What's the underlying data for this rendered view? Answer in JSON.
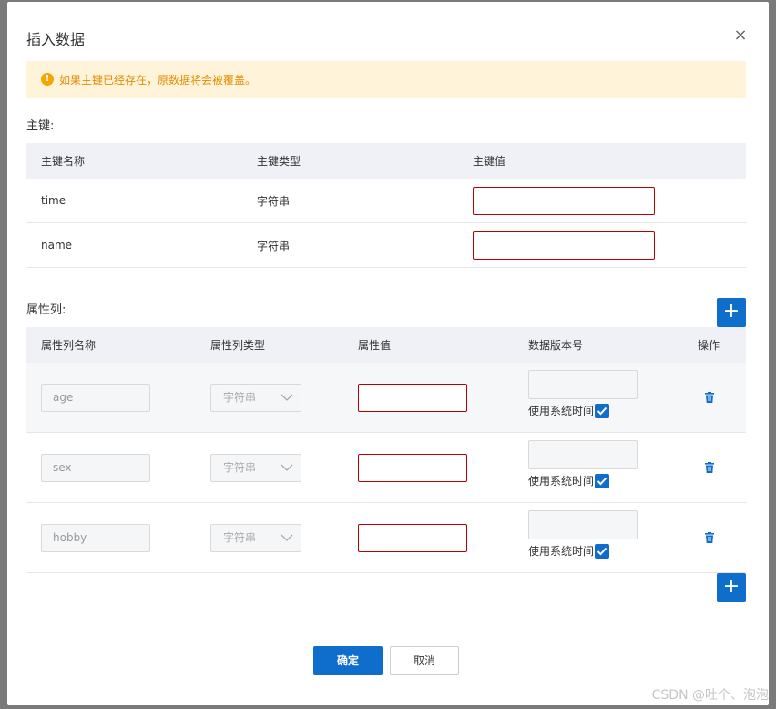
{
  "dialog": {
    "title": "插入数据",
    "close_icon": "×"
  },
  "alert": {
    "icon": "!",
    "text": "如果主键已经存在，原数据将会被覆盖。"
  },
  "primary_keys": {
    "section_label": "主键:",
    "headers": [
      "主键名称",
      "主键类型",
      "主键值"
    ],
    "rows": [
      {
        "name": "time",
        "type": "字符串",
        "value": ""
      },
      {
        "name": "name",
        "type": "字符串",
        "value": ""
      }
    ]
  },
  "attributes": {
    "section_label": "属性列:",
    "headers": [
      "属性列名称",
      "属性列类型",
      "属性值",
      "数据版本号",
      "操作"
    ],
    "rows": [
      {
        "name": "age",
        "type": "字符串",
        "value": "",
        "version": "",
        "use_system_time": "使用系统时间",
        "checked": true
      },
      {
        "name": "sex",
        "type": "字符串",
        "value": "",
        "version": "",
        "use_system_time": "使用系统时间",
        "checked": true
      },
      {
        "name": "hobby",
        "type": "字符串",
        "value": "",
        "version": "",
        "use_system_time": "使用系统时间",
        "checked": true
      }
    ],
    "add_label": "+"
  },
  "footer": {
    "ok_label": "确定",
    "cancel_label": "取消"
  },
  "watermark": "CSDN @吐个、泡泡",
  "colors": {
    "primary": "#0f6dcc",
    "alert_bg": "#fff4d9",
    "alert_text": "#e38a00",
    "error_border": "#b40000"
  }
}
